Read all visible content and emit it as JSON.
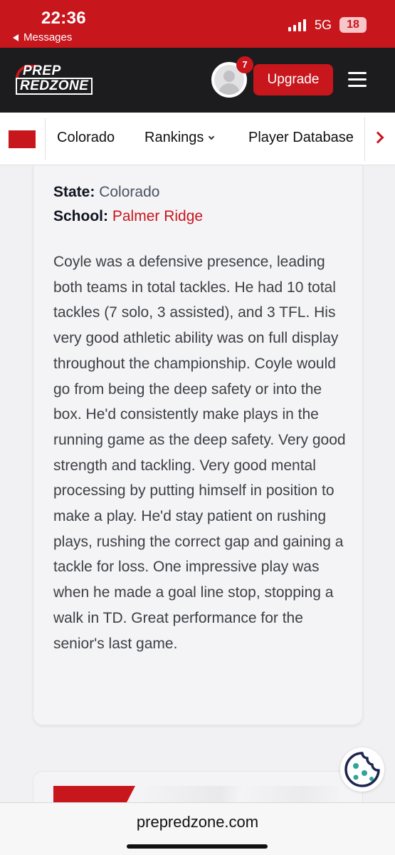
{
  "status_bar": {
    "time": "22:36",
    "back_label": "Messages",
    "network": "5G",
    "battery": "18"
  },
  "header": {
    "logo_line1": "PREP",
    "logo_line2": "REDZONE",
    "notification_count": "7",
    "upgrade_label": "Upgrade"
  },
  "subnav": {
    "items": [
      {
        "label": "Colorado"
      },
      {
        "label": "Rankings"
      },
      {
        "label": "Player Database"
      }
    ]
  },
  "profile": {
    "state_label": "State:",
    "state_value": "Colorado",
    "school_label": "School:",
    "school_value": "Palmer Ridge",
    "writeup": "Coyle was a defensive presence, leading both teams in total tackles. He had 10 total tackles (7 solo, 3 assisted), and 3 TFL. His very good athletic ability was on full display throughout the championship. Coyle would go from being the deep safety or into the box. He'd consistently make plays in the running game as the deep safety. Very good strength and tackling. Very good mental processing by putting himself in position to make a play. He'd stay patient on rushing plays, rushing the correct gap and gaining a tackle for loss. One impressive play was when he made a goal line stop, stopping a walk in TD. Great performance for the senior's last game."
  },
  "browser": {
    "url": "prepredzone.com"
  },
  "colors": {
    "brand_red": "#c8161d",
    "header_dark": "#1c1c1e",
    "page_bg": "#f1f1f3",
    "cookie_teal": "#2fa598",
    "cookie_navy": "#1f2650"
  }
}
